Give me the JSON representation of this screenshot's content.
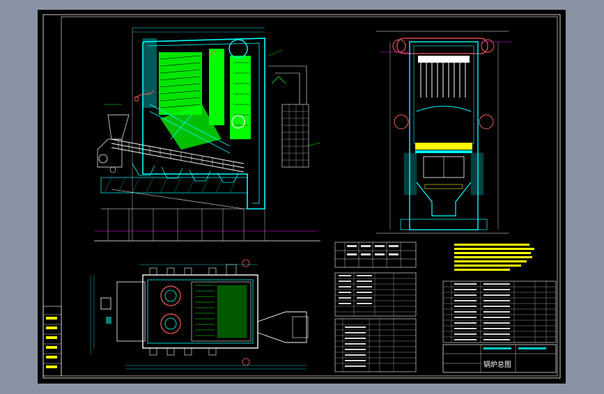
{
  "title_block": {
    "drawing_title": "锅炉总图"
  },
  "colors": {
    "background": "#000000",
    "frame": "#ffffff",
    "walls": "#00ffff",
    "tubes": "#00ff00",
    "steam": "#ff5a5a",
    "notes": "#ffff00",
    "grate": "#ffffff",
    "dims": "#00ffff"
  },
  "icons": {
    "drum": "drum-icon",
    "burner": "burner-icon",
    "fan": "fan-icon"
  }
}
